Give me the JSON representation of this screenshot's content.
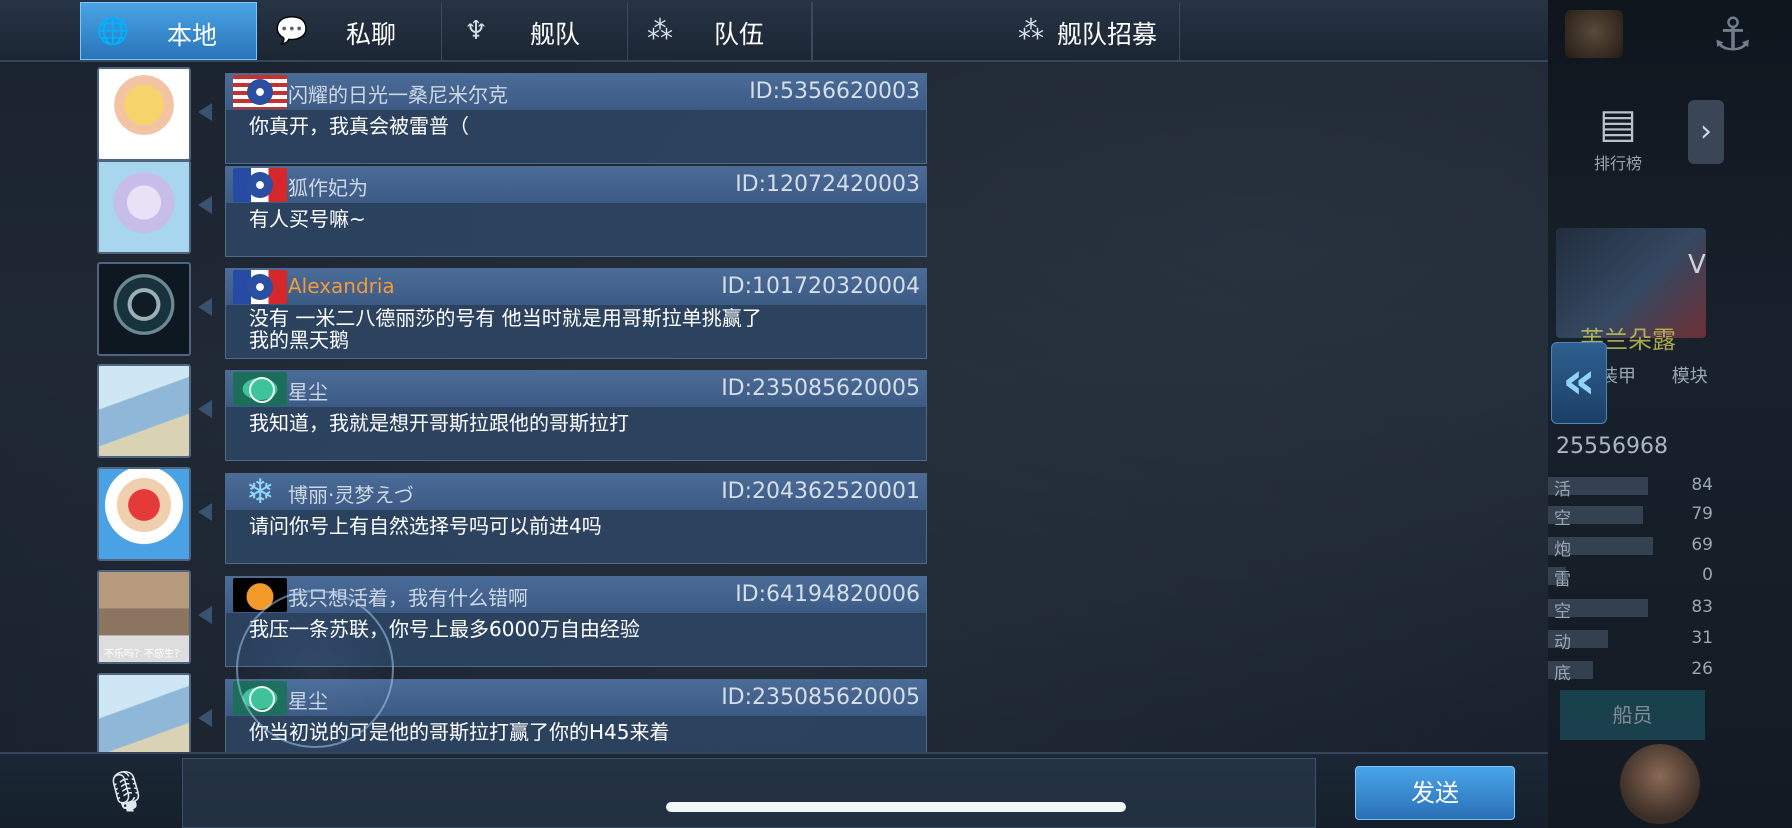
{
  "tabs": [
    {
      "label": "本地",
      "icon": "globe-icon",
      "active": true
    },
    {
      "label": "私聊",
      "icon": "chat-bubble-icon",
      "active": false
    },
    {
      "label": "舰队",
      "icon": "fleet-emblem-icon",
      "active": false
    },
    {
      "label": "队伍",
      "icon": "team-dots-icon",
      "active": false
    },
    {
      "label": "舰队招募",
      "icon": "team-dots-icon",
      "active": false
    }
  ],
  "messages": [
    {
      "name": "闪耀的日光一桑尼米尔克",
      "id": "ID:5356620003",
      "text": "你真开，我真会被雷普（",
      "flag": "us-flag-icon",
      "name_color": "#cdd8e4"
    },
    {
      "name": "狐作妃为",
      "id": "ID:12072420003",
      "text": "有人买号嘛~",
      "flag": "france-flag-icon",
      "name_color": "#cdd8e4"
    },
    {
      "name": "Alexandria",
      "id": "ID:101720320004",
      "text": " 没有 一米二八德丽莎的号有 他当时就是用哥斯拉单挑赢了我的黑天鹅",
      "flag": "france-flag-icon",
      "name_color": "#f39b3a"
    },
    {
      "name": "星尘",
      "id": "ID:235085620005",
      "text": "我知道，我就是想开哥斯拉跟他的哥斯拉打",
      "flag": "green-emblem-icon",
      "name_color": "#cdd8e4"
    },
    {
      "name": "博丽·灵梦えづ",
      "id": "ID:204362520001",
      "text": "请问你号上有自然选择号吗可以前进4吗",
      "flag": "snowflake-icon",
      "name_color": "#cdd8e4"
    },
    {
      "name": "我只想活着，我有什么错啊",
      "id": "ID:64194820006",
      "text": "我压一条苏联，你号上最多6000万自由经验",
      "flag": "pumpkin-icon",
      "name_color": "#cdd8e4"
    },
    {
      "name": "星尘",
      "id": "ID:235085620005",
      "text": "你当初说的可是他的哥斯拉打赢了你的H45来着",
      "flag": "green-emblem-icon",
      "name_color": "#cdd8e4"
    }
  ],
  "avatar6_caption": "不乐吗？不感生？",
  "input": {
    "value": "",
    "placeholder": ""
  },
  "send_label": "发送",
  "background_panel": {
    "rank_label": "排行榜",
    "ship_name": "芙兰朵露",
    "tab_a": "装甲",
    "tab_b": "模块",
    "player_id": "25556968",
    "letter_v": "V",
    "stats": [
      {
        "name": "活",
        "value": "84"
      },
      {
        "name": "空",
        "value": "79"
      },
      {
        "name": "炮",
        "value": "69"
      },
      {
        "name": "雷",
        "value": "0"
      },
      {
        "name": "空",
        "value": "83"
      },
      {
        "name": "动",
        "value": "31"
      },
      {
        "name": "底",
        "value": "26"
      }
    ],
    "crew_label": "船员"
  },
  "colors": {
    "accent": "#3f8fd6",
    "bubble": "#2e4666",
    "header": "#4b6c98",
    "orange_name": "#f39b3a"
  }
}
